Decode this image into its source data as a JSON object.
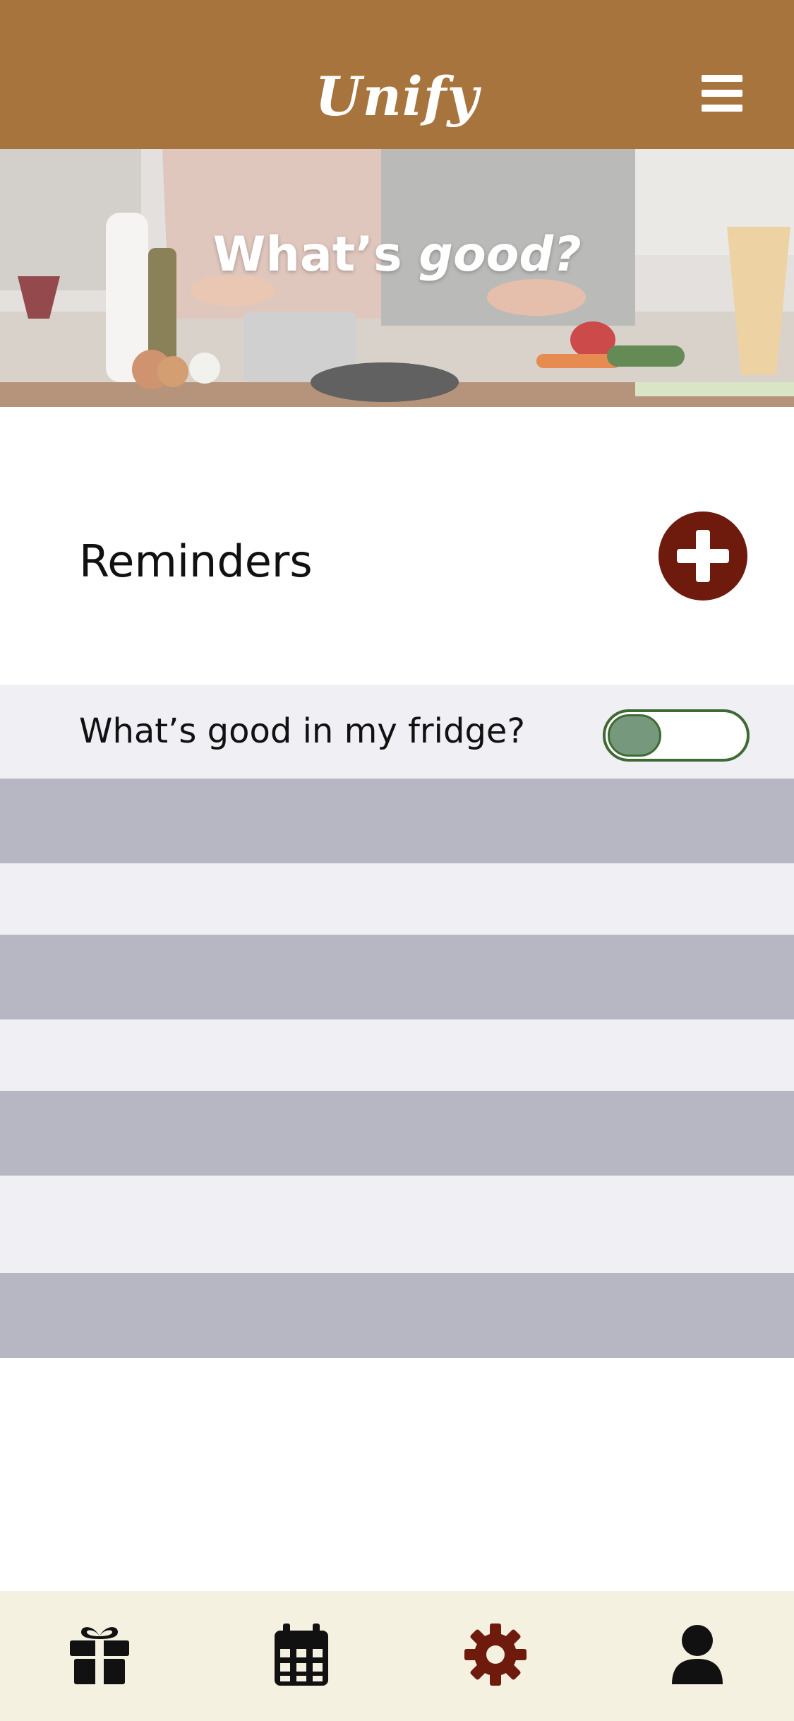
{
  "header": {
    "app_title": "Unify",
    "menu_icon": "hamburger-menu-icon"
  },
  "hero": {
    "title_part1": "What’s ",
    "title_part2": "good?"
  },
  "reminders": {
    "title": "Reminders",
    "add_icon": "plus-circle-icon",
    "items": [
      {
        "label": "What’s good in my fridge?",
        "toggle_on": false
      }
    ]
  },
  "bottom_nav": {
    "items": [
      {
        "icon": "gift-icon",
        "color": "#111111"
      },
      {
        "icon": "calendar-icon",
        "color": "#111111"
      },
      {
        "icon": "settings-gear-icon",
        "color": "#6e1a0d",
        "active": true
      },
      {
        "icon": "user-icon",
        "color": "#111111"
      }
    ]
  },
  "colors": {
    "header_bg": "#a8743e",
    "accent": "#6e1a0d",
    "toggle_border": "#3f6a33",
    "toggle_knob": "#76997e",
    "row_light": "#efeff4",
    "row_dark": "#b7b7c3",
    "nav_bg": "#f5f1e1"
  }
}
